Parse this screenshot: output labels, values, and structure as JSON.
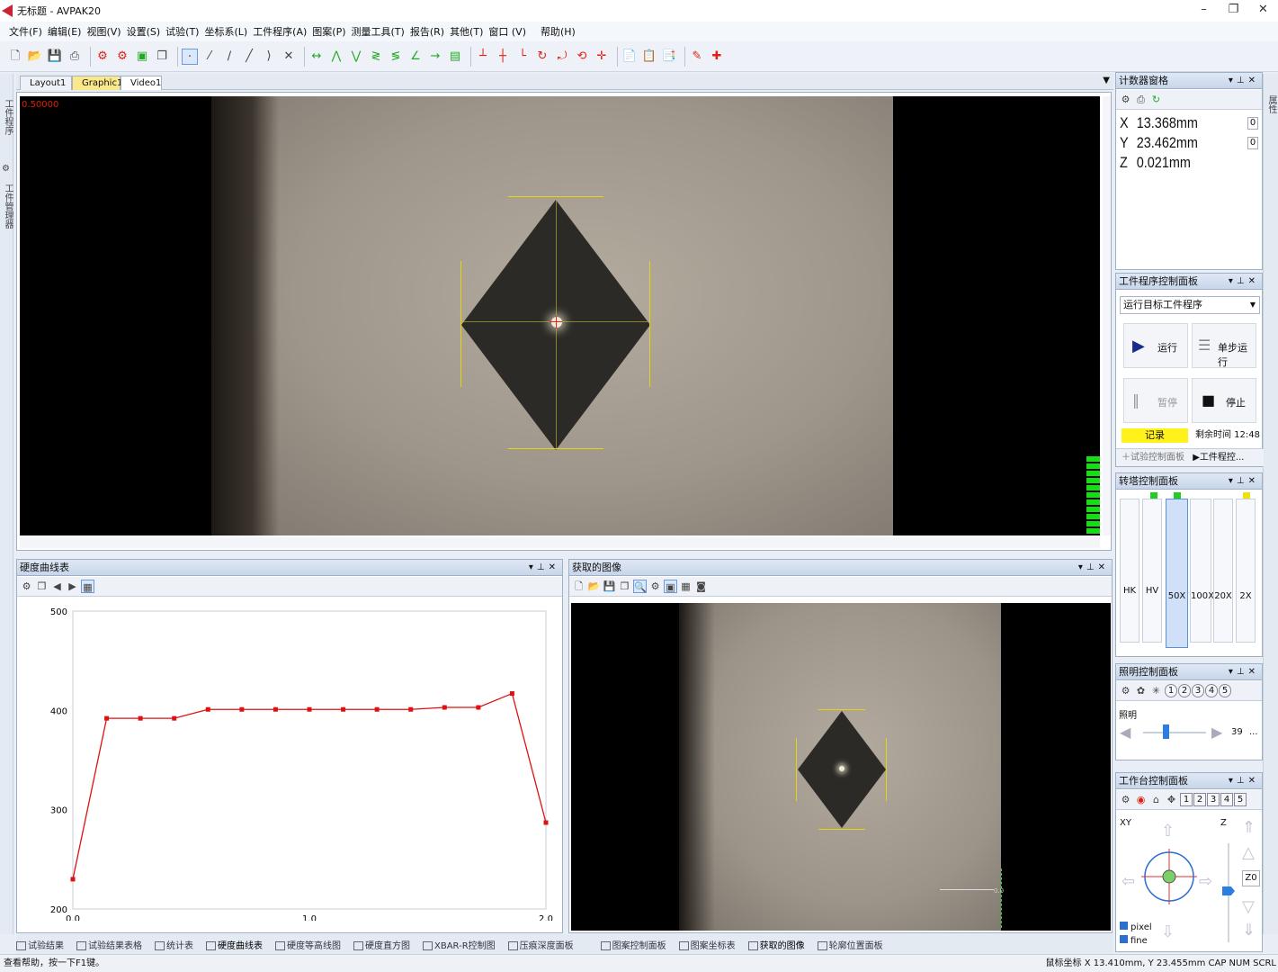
{
  "window": {
    "title": "无标题 - AVPAK20",
    "min": "–",
    "max": "❐",
    "close": "✕"
  },
  "menu": [
    "文件(F)",
    "编辑(E)",
    "视图(V)",
    "设置(S)",
    "试验(T)",
    "坐标系(L)",
    "工件程序(A)",
    "图案(P)",
    "测量工具(T)",
    "报告(R)",
    "其他(T)",
    "窗口 (V)",
    "帮助(H)"
  ],
  "left_strip": {
    "label1": "工件程序",
    "label2": "工件管理器"
  },
  "right_strip": {
    "label": "属性"
  },
  "doc_tabs": [
    "Layout1",
    "Graphic1",
    "Video1"
  ],
  "video": {
    "zoom_label": "0.50000"
  },
  "hardness_panel": {
    "title": "硬度曲线表",
    "chart_data": {
      "type": "line",
      "x": [
        0.0,
        0.14,
        0.28,
        0.42,
        0.56,
        0.7,
        0.84,
        0.98,
        1.12,
        1.26,
        1.4,
        1.54,
        1.68,
        1.82,
        1.96,
        2.1
      ],
      "y": [
        230,
        392,
        392,
        392,
        401,
        401,
        401,
        401,
        401,
        401,
        401,
        403,
        403,
        417,
        287
      ],
      "xlim": [
        0,
        2.0
      ],
      "ylim": [
        200,
        500
      ],
      "x_ticks": [
        "0.0",
        "1.0",
        "2.0"
      ],
      "y_ticks": [
        "500",
        "400",
        "300",
        "200"
      ],
      "color": "#dd1111",
      "grid": false
    }
  },
  "image_panel": {
    "title": "获取的图像",
    "scale_label": "0.0"
  },
  "counter_panel": {
    "title": "计数器窗格",
    "x_label": "X",
    "x_value": "13.368mm",
    "x_box": "0",
    "y_label": "Y",
    "y_value": "23.462mm",
    "y_box": "0",
    "z_label": "Z",
    "z_value": "0.021mm"
  },
  "program_panel": {
    "title": "工件程序控制面板",
    "dropdown": "运行目标工件程序",
    "run": "运行",
    "step": "单步运行",
    "pause": "暂停",
    "stop": "停止",
    "record": "记录",
    "remaining": "剩余时间 12:48",
    "tab1": "试验控制面板",
    "tab2": "工件程控..."
  },
  "turret_panel": {
    "title": "转塔控制面板",
    "lenses": [
      "HK",
      "HV",
      "50X",
      "100X",
      "20X",
      "2X"
    ]
  },
  "light_panel": {
    "title": "照明控制面板",
    "nums": [
      "1",
      "2",
      "3",
      "4",
      "5"
    ],
    "label": "照明",
    "value": "39",
    "more": "..."
  },
  "stage_panel": {
    "title": "工作台控制面板",
    "nums": [
      "1",
      "2",
      "3",
      "4",
      "5"
    ],
    "xy": "XY",
    "z": "Z",
    "z0": "Z0",
    "pixel": "pixel",
    "fine": "fine"
  },
  "bottom_tabs_left": [
    "试验结果",
    "试验结果表格",
    "统计表",
    "硬度曲线表",
    "硬度等高线图",
    "硬度直方图",
    "XBAR-R控制图",
    "压痕深度面板"
  ],
  "bottom_tabs_right": [
    "图案控制面板",
    "图案坐标表",
    "获取的图像",
    "轮廓位置面板"
  ],
  "status": {
    "left": "查看帮助，按一下F1键。",
    "right": "鼠标坐标 X 13.410mm, Y 23.455mm CAP NUM SCRL"
  }
}
